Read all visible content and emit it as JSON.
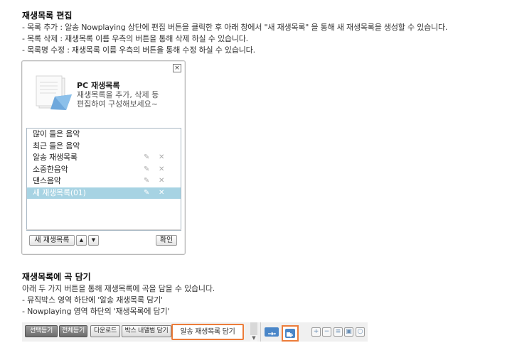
{
  "section1": {
    "title": "재생목록 편집",
    "lines": [
      "- 목록 추가 : 알송 Nowplaying 상단에 편집 버튼을 클릭한 후 아래 창에서 \"새 재생목록\" 을 통해 새 재생목록을 생성할 수 있습니다.",
      "- 목록 삭제 : 재생목록 이름 우측의 버튼을 통해 삭제 하실 수 있습니다.",
      "- 목록명 수정 : 재생목록 이름 우측의 버튼을 통해 수정 하실 수 있습니다."
    ]
  },
  "dialog": {
    "close_icon": "×",
    "title": "PC 재생목록",
    "desc_line1": "재생목록을 추가, 삭제 등",
    "desc_line2": "편집하여 구성해보세요~",
    "items": [
      {
        "label": "많이 들은 음악",
        "editable": false
      },
      {
        "label": "최근 들은 음악",
        "editable": false
      },
      {
        "label": "알송 재생목록",
        "editable": true
      },
      {
        "label": "소중한음악",
        "editable": true
      },
      {
        "label": "댄스음악",
        "editable": true
      },
      {
        "label": "새 재생목록(01)",
        "editable": true,
        "selected": true
      }
    ],
    "edit_icon": "✎",
    "delete_icon": "✕",
    "new_button": "새 재생목록",
    "up_button": "▲",
    "down_button": "▼",
    "ok_button": "확인"
  },
  "section2": {
    "title": "재생목록에 곡 담기",
    "lines": [
      "아래 두 가지 버튼을 통해 재생목록에 곡을 담을 수 있습니다.",
      "- 뮤직박스 영역 하단에 '알송 재생목록 담기'",
      "- Nowplaying 영역 하단의 '재생목록에 담기'"
    ]
  },
  "toolbar": {
    "select_listen": "선택듣기",
    "all_listen": "전체듣기",
    "download": "다운로드",
    "box_album": "박스 내앨범 담기",
    "alsong_playlist": "알송 재생목록 담기",
    "scroll_down": "▼",
    "icons": [
      "plus-icon",
      "minus-icon",
      "list-icon",
      "save-icon",
      "search-icon"
    ]
  },
  "colors": {
    "highlight": "#ec7c3a",
    "selected_row": "#a7d3e3",
    "accent_button": "#4a86c8"
  }
}
